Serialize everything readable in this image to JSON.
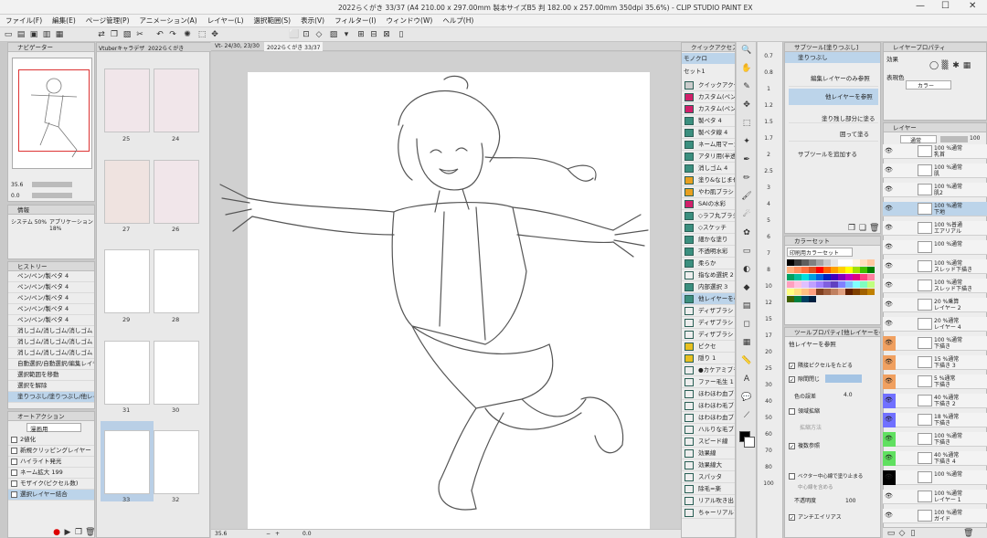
{
  "window": {
    "title": "2022らくがき 33/37 (A4 210.00 x 297.00mm 製本サイズB5 判 182.00 x 257.00mm 350dpi 35.6%) - CLIP STUDIO PAINT EX",
    "minimize": "—",
    "maximize": "☐",
    "close": "✕"
  },
  "menu": [
    "ファイル(F)",
    "編集(E)",
    "ページ管理(P)",
    "アニメーション(A)",
    "レイヤー(L)",
    "選択範囲(S)",
    "表示(V)",
    "フィルター(I)",
    "ウィンドウ(W)",
    "ヘルプ(H)"
  ],
  "navigator": {
    "title": "ナビゲーター",
    "zoom": "35.6",
    "angle": "0.0"
  },
  "info": {
    "title": "情報",
    "system": "システム 50%",
    "application": "アプリケーション 18%"
  },
  "history": {
    "title": "ヒストリー",
    "items": [
      "ペン/ペン/製ペタ 4",
      "ペン/ペン/製ペタ 4",
      "ペン/ペン/製ペタ 4",
      "ペン/ペン/製ペタ 4",
      "ペン/ペン/製ペタ 4",
      "消しゴム/消しゴム/消しゴム 4",
      "消しゴム/消しゴム/消しゴム 4",
      "消しゴム/消しゴム/消しゴム 4",
      "自動選択/自動選択/編集レイヤーのみ参照",
      "選択範囲を移動",
      "選択を解除",
      "塗りつぶし/塗りつぶし/他レイヤーを参照"
    ]
  },
  "auto_action": {
    "title": "オートアクション",
    "set": "漫画用",
    "items": [
      "2値化",
      "新規クリッピングレイヤー",
      "ハイライト発光",
      "ネーム拡大 199",
      "モザイク(ピクセル数)",
      "選択レイヤー結合"
    ]
  },
  "page_tabs": [
    "Vtuberキャラデザ",
    "2022らくがき"
  ],
  "pages": [
    "25",
    "24",
    "27",
    "26",
    "29",
    "28",
    "31",
    "30",
    "33",
    "32"
  ],
  "canvas_tabs": [
    "Vt- 24/30, 23/30",
    "2022らくがき 33/37"
  ],
  "canvas_status": {
    "zoom": "35.6",
    "angle": "0.0"
  },
  "quick_access": {
    "title": "クイックアクセス",
    "set": "モノクロ",
    "subset": "セット1"
  },
  "brushes": [
    "クイックアクセス1",
    "カスタム(ペン)1",
    "カスタム(ペン)2",
    "製ペタ 4",
    "製ペタ線 4",
    "ネーム用マーカー",
    "アタリ用(半透明)",
    "消しゴム 4",
    "塗り&なじませ",
    "やわ肌ブラシ",
    "SAIの水彩",
    "◇ラフ丸ブラシ",
    "◇スケッチ",
    "細かな塗り",
    "不透明水彩",
    "柔らか",
    "指なめ選択 2",
    "内部選択 3",
    "他レイヤーを参照",
    "ディザブラシ",
    "ディザブラシ",
    "ディザブラシ",
    "ピクセ",
    "隠り 1",
    "●カケアミブラシ",
    "ファー毛生 1",
    "ほわほわ血ブラシ",
    "ほわほわ毛ブラシ",
    "はわほわ血ブラシ",
    "ハルりな毛ブラシ",
    "スピード線",
    "効果線",
    "効果線大",
    "スパッタ",
    "除毛=楽",
    "リアル吹き出し",
    "ちゃーリアルファー"
  ],
  "brush_sizes": [
    "0.7",
    "0.8",
    "1",
    "1.2",
    "1.5",
    "1.7",
    "2",
    "2.5",
    "3",
    "4",
    "5",
    "6",
    "7",
    "8",
    "10",
    "12",
    "15",
    "17",
    "20",
    "25",
    "30",
    "40",
    "50",
    "60",
    "70",
    "80",
    "100"
  ],
  "subtool": {
    "title": "サブツール[塗りつぶし]",
    "group": "塗りつぶし",
    "items": [
      "編集レイヤーのみ参照",
      "他レイヤーを参照",
      "塗り残し部分に塗る",
      "囲って塗る"
    ],
    "add": "サブツールを追加する"
  },
  "color_set": {
    "title": "カラーセット",
    "set": "印刷用カラーセット",
    "palette": [
      "#000000",
      "#3a3a3a",
      "#5e5e5e",
      "#808080",
      "#a4a4a4",
      "#c8c8c8",
      "#e6e6e6",
      "#ffffff",
      "#ffffff",
      "#fff4e0",
      "#ffe0c0",
      "#ffc8a0",
      "#ffb080",
      "#ff9060",
      "#ff7040",
      "#e05020",
      "#ff0000",
      "#ff6000",
      "#ffa000",
      "#ffd000",
      "#ffff00",
      "#a0e000",
      "#40c000",
      "#008000",
      "#00a060",
      "#00c0a0",
      "#00e0e0",
      "#00a0e0",
      "#0060e0",
      "#0020c0",
      "#4000c0",
      "#8000c0",
      "#c000c0",
      "#e00080",
      "#ff4080",
      "#ff80a0",
      "#ffa0c0",
      "#ffc0e0",
      "#e0c0ff",
      "#c0a0ff",
      "#a080ff",
      "#8060e0",
      "#6040c0",
      "#8080ff",
      "#80c0ff",
      "#80ffff",
      "#80ffc0",
      "#c0ff80",
      "#ffff80",
      "#ffe080",
      "#ffc080",
      "#ffa080",
      "#804020",
      "#a06040",
      "#c08060",
      "#e0a080",
      "#602000",
      "#804000",
      "#a06000",
      "#c08000",
      "#406000",
      "#008040",
      "#004060",
      "#002040"
    ]
  },
  "tool_property": {
    "title": "ツールプロパティ[他レイヤーを参照]",
    "tool": "他レイヤーを参照",
    "opt_gap": "隣接ピクセルをたどる",
    "opt_close": "隙間閉じ",
    "opt_tolerance": "色の誤差",
    "tolerance": "4.0",
    "opt_expand": "領域拡縮",
    "expand_method": "拡縮方法",
    "opt_multi": "複数参照",
    "opt_vector": "ベクター中心線で塗り止まる",
    "opt_center": "中心線を含める",
    "opacity_label": "不透明度",
    "opacity": "100",
    "antialias": "アンチエイリアス"
  },
  "layer_property": {
    "title": "レイヤープロパティ",
    "effect": "効果",
    "expression": "表現色",
    "color_mode": "カラー"
  },
  "layer_panel": {
    "title": "レイヤー",
    "blend": "通常",
    "opacity": "100"
  },
  "layers": [
    {
      "name": "100 %通常",
      "sub": "乳首",
      "color": ""
    },
    {
      "name": "100 %通常",
      "sub": "肌",
      "color": ""
    },
    {
      "name": "100 %通常",
      "sub": "肌2",
      "color": ""
    },
    {
      "name": "100 %通常",
      "sub": "下地",
      "color": "",
      "selected": true
    },
    {
      "name": "100 %普通",
      "sub": "エアリアル",
      "color": ""
    },
    {
      "name": "100 %通常",
      "sub": "",
      "color": ""
    },
    {
      "name": "100 %通常",
      "sub": "スレッド下描き",
      "color": ""
    },
    {
      "name": "100 %通常",
      "sub": "スレッド下描き",
      "color": ""
    },
    {
      "name": "20 %乗算",
      "sub": "レイヤー 2",
      "color": ""
    },
    {
      "name": "20 %通常",
      "sub": "レイヤー 4",
      "color": ""
    },
    {
      "name": "100 %通常",
      "sub": "下描き",
      "color": "#f0a060"
    },
    {
      "name": "15 %通常",
      "sub": "下描き 3",
      "color": "#f0a060"
    },
    {
      "name": "5 %通常",
      "sub": "下描き",
      "color": "#f0a060"
    },
    {
      "name": "40 %通常",
      "sub": "下描き 2",
      "color": "#7070ff"
    },
    {
      "name": "18 %通常",
      "sub": "下描き",
      "color": "#7070ff"
    },
    {
      "name": "100 %通常",
      "sub": "下描き",
      "color": "#60e060"
    },
    {
      "name": "40 %通常",
      "sub": "下描き 4",
      "color": "#60e060"
    },
    {
      "name": "100 %通常",
      "sub": "",
      "color": "#000000"
    },
    {
      "name": "100 %通常",
      "sub": "レイヤー 1",
      "color": ""
    },
    {
      "name": "100 %通常",
      "sub": "ガイド",
      "color": ""
    }
  ]
}
